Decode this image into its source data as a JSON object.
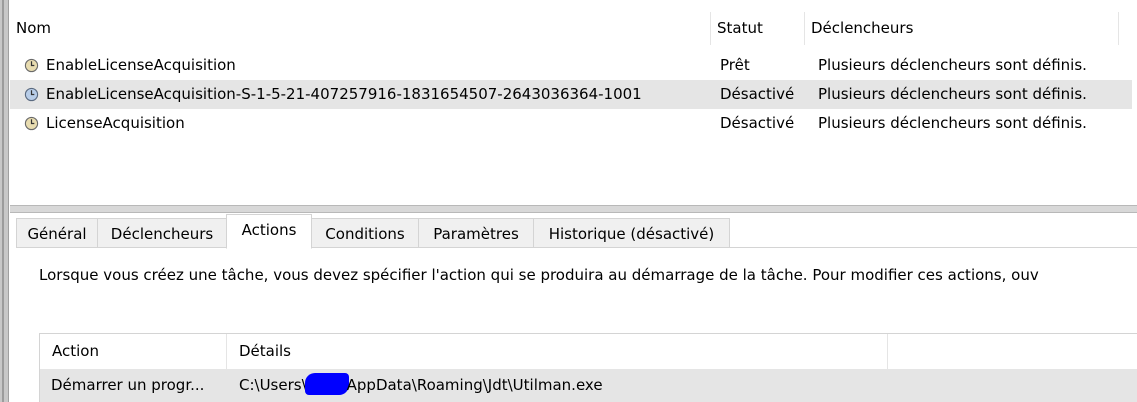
{
  "task_list": {
    "columns": {
      "name": "Nom",
      "status": "Statut",
      "triggers": "Déclencheurs"
    },
    "rows": [
      {
        "name": "EnableLicenseAcquisition",
        "status": "Prêt",
        "triggers": "Plusieurs déclencheurs sont définis.",
        "icon": "clock-icon",
        "selected": false
      },
      {
        "name": "EnableLicenseAcquisition-S-1-5-21-407257916-1831654507-2643036364-1001",
        "status": "Désactivé",
        "triggers": "Plusieurs déclencheurs sont définis.",
        "icon": "clock-icon",
        "selected": true
      },
      {
        "name": "LicenseAcquisition",
        "status": "Désactivé",
        "triggers": "Plusieurs déclencheurs sont définis.",
        "icon": "clock-icon",
        "selected": false
      }
    ]
  },
  "tabs": {
    "general": "Général",
    "triggers": "Déclencheurs",
    "actions": "Actions",
    "conditions": "Conditions",
    "settings": "Paramètres",
    "history": "Historique (désactivé)",
    "active": "Actions"
  },
  "actions_panel": {
    "description": "Lorsque vous créez une tâche, vous devez spécifier l'action qui se produira au démarrage de la tâche. Pour modifier ces actions, ouv",
    "columns": {
      "action": "Action",
      "details": "Détails"
    },
    "rows": [
      {
        "action": "Démarrer un progr...",
        "details_prefix": "C:\\Users\\",
        "details_suffix": "AppData\\Roaming\\Jdt\\Utilman.exe"
      }
    ]
  },
  "colors": {
    "selected_row": "#e5e5e5",
    "redaction": "#0000ff",
    "icon_face": "#e8dcb0",
    "icon_face_selected": "#b8cde8"
  }
}
